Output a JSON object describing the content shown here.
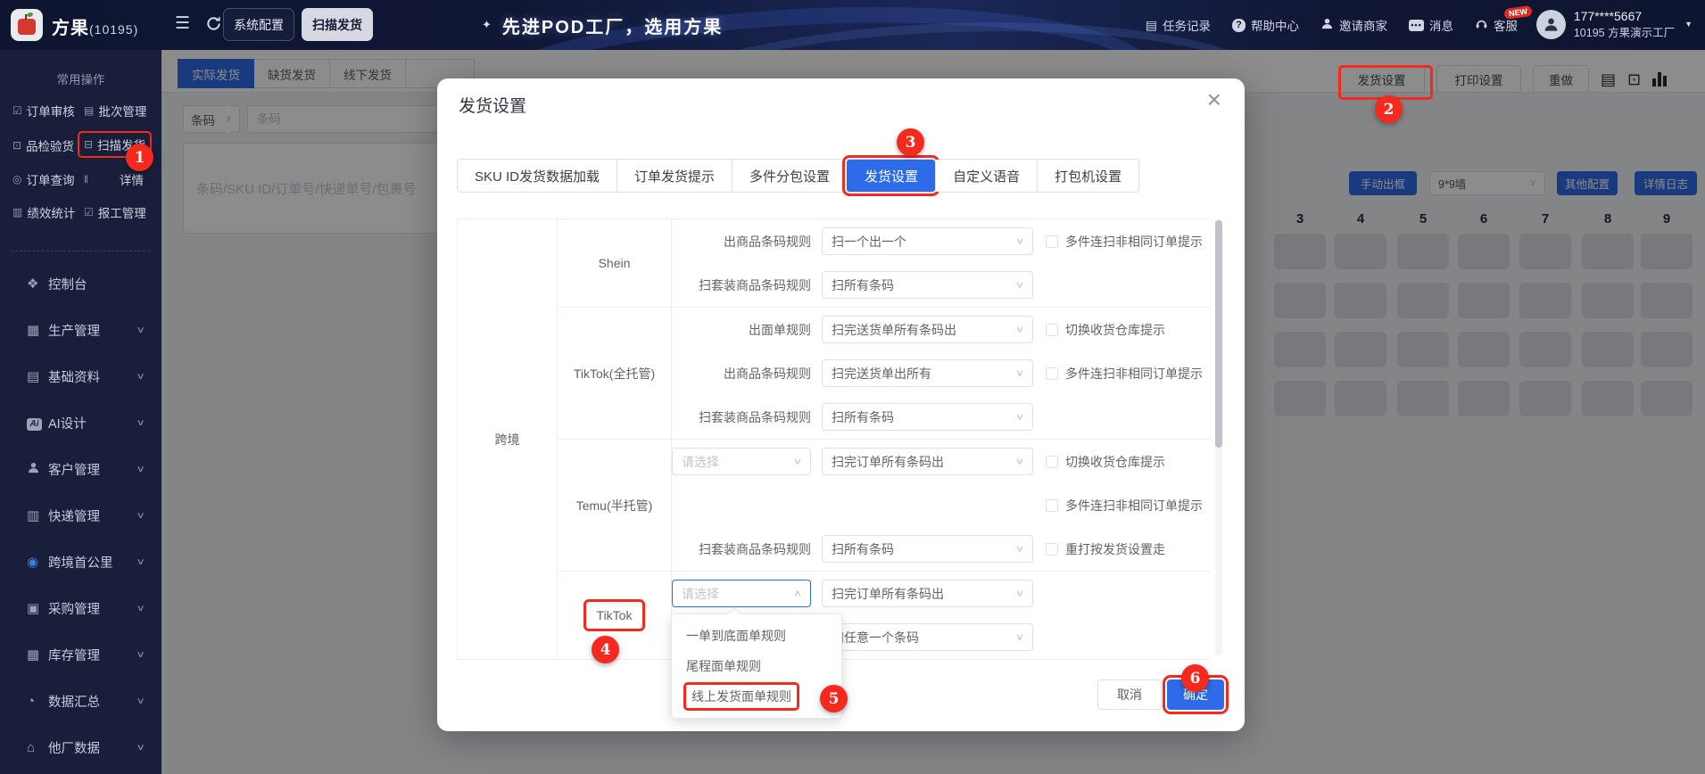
{
  "topbar": {
    "logo_text": "方果",
    "logo_suffix": "(10195)",
    "btn_system_config": "系统配置",
    "btn_scan_ship": "扫描发货",
    "slogan_star": "✦",
    "slogan": "先进POD工厂，选用方果",
    "nav": [
      {
        "label": "任务记录",
        "icon": "task-icon"
      },
      {
        "label": "帮助中心",
        "icon": "help-icon"
      },
      {
        "label": "邀请商家",
        "icon": "invite-icon"
      },
      {
        "label": "消息",
        "icon": "message-icon"
      },
      {
        "label": "客服",
        "icon": "service-icon",
        "badge": "NEW"
      }
    ],
    "user_phone": "177****5667",
    "user_factory": "10195 方果演示工厂"
  },
  "sidebar": {
    "section_title": "常用操作",
    "quick_items": [
      {
        "label": "订单审核",
        "icon": "☑"
      },
      {
        "label": "批次管理",
        "icon": "▤"
      },
      {
        "label": "品检验货",
        "icon": "⊡"
      },
      {
        "label": "扫描发货",
        "icon": "⊟",
        "highlight": true
      },
      {
        "label": "订单查询",
        "icon": "◎"
      },
      {
        "label": "详情",
        "icon": "‖",
        "covered": true
      },
      {
        "label": "绩效统计",
        "icon": "▥"
      },
      {
        "label": "报工管理",
        "icon": "☑"
      }
    ],
    "menu": [
      {
        "label": "控制台",
        "icon": "❖",
        "expandable": false
      },
      {
        "label": "生产管理",
        "icon": "▦",
        "expandable": true
      },
      {
        "label": "基础资料",
        "icon": "▤",
        "expandable": true
      },
      {
        "label": "AI设计",
        "icon": "Ai",
        "expandable": true
      },
      {
        "label": "客户管理",
        "icon": "person",
        "expandable": true
      },
      {
        "label": "快递管理",
        "icon": "▥",
        "expandable": true
      },
      {
        "label": "跨境首公里",
        "icon": "globe",
        "expandable": true
      },
      {
        "label": "采购管理",
        "icon": "▣",
        "expandable": true
      },
      {
        "label": "库存管理",
        "icon": "▦",
        "expandable": true
      },
      {
        "label": "数据汇总",
        "icon": "◔",
        "expandable": true
      },
      {
        "label": "他厂数据",
        "icon": "⌂",
        "expandable": true
      }
    ]
  },
  "content": {
    "tabs": [
      "实际发货",
      "缺货发货",
      "线下发货"
    ],
    "active_tab": "实际发货",
    "filter_select": "条码",
    "filter_input_placeholder": "条码",
    "search_placeholder": "条码/SKU ID/订单号/快递单号/包裹号",
    "toolbar": {
      "ship_settings": "发货设置",
      "print_settings": "打印设置",
      "redo": "重做"
    },
    "panel": {
      "manual_out": "手动出框",
      "wall_select": "9*9墙",
      "other_config": "其他配置",
      "detail_log": "详情日志"
    },
    "wall_columns": [
      "3",
      "4",
      "5",
      "6",
      "7",
      "8",
      "9"
    ],
    "wall_rows": 4
  },
  "modal": {
    "title": "发货设置",
    "tabs": [
      "SKU ID发货数据加载",
      "订单发货提示",
      "多件分包设置",
      "发货设置",
      "自定义语音",
      "打包机设置"
    ],
    "active_tab": "发货设置",
    "group_label": "跨境",
    "rows": [
      {
        "platform": "Shein",
        "lines": [
          {
            "label": "出商品条码规则",
            "value": "扫一个出一个",
            "checks": [
              "多件连扫非相同订单提示"
            ]
          },
          {
            "label": "扫套装商品条码规则",
            "value": "扫所有条码",
            "checks": []
          }
        ]
      },
      {
        "platform": "TikTok(全托管)",
        "lines": [
          {
            "label": "出面单规则",
            "value": "扫完送货单所有条码出",
            "checks": [
              "切换收货仓库提示"
            ]
          },
          {
            "label": "出商品条码规则",
            "value": "扫完送货单出所有",
            "checks": [
              "多件连扫非相同订单提示"
            ]
          },
          {
            "label": "扫套装商品条码规则",
            "value": "扫所有条码",
            "checks": []
          }
        ]
      },
      {
        "platform": "Temu(半托管)",
        "lines": [
          {
            "preselect": "请选择",
            "value": "扫完订单所有条码出",
            "checks": [
              "切换收货仓库提示"
            ]
          },
          {
            "checks": [
              "多件连扫非相同订单提示"
            ]
          },
          {
            "label": "扫套装商品条码规则",
            "value": "扫所有条码",
            "checks": [
              "重打按发货设置走"
            ]
          }
        ]
      },
      {
        "platform": "TikTok",
        "highlight": true,
        "lines": [
          {
            "preselect": "请选择",
            "preselect_open": true,
            "value": "扫完订单所有条码出",
            "checks": []
          },
          {
            "value": "扫任意一个条码",
            "checks": []
          }
        ]
      }
    ],
    "cancel": "取消",
    "confirm": "确定"
  },
  "dropdown": {
    "options": [
      "一单到底面单规则",
      "尾程面单规则",
      "线上发货面单规则"
    ],
    "highlighted": "线上发货面单规则"
  },
  "annotations": {
    "color": "#f5291d",
    "steps": [
      "1",
      "2",
      "3",
      "4",
      "5",
      "6"
    ]
  }
}
